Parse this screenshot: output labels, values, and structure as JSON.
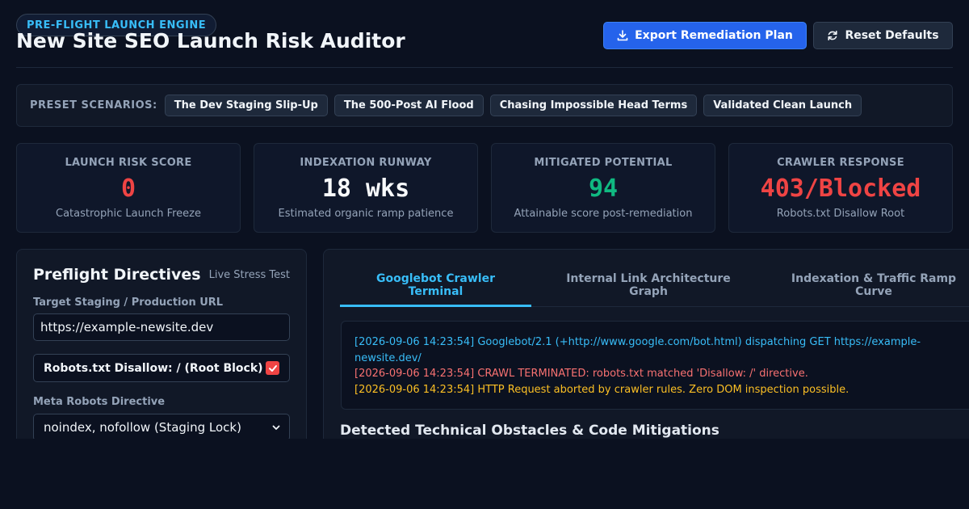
{
  "header": {
    "badge": "PRE-FLIGHT LAUNCH ENGINE",
    "title": "New Site SEO Launch Risk Auditor",
    "export_label": "Export Remediation Plan",
    "reset_label": "Reset Defaults"
  },
  "presets": {
    "label": "PRESET SCENARIOS:",
    "items": [
      "The Dev Staging Slip-Up",
      "The 500-Post AI Flood",
      "Chasing Impossible Head Terms",
      "Validated Clean Launch"
    ]
  },
  "metrics": [
    {
      "label": "LAUNCH RISK SCORE",
      "value": "0",
      "sub": "Catastrophic Launch Freeze",
      "color": "#ef4444"
    },
    {
      "label": "INDEXATION RUNWAY",
      "value": "18 wks",
      "sub": "Estimated organic ramp patience",
      "color": "#f8fafc"
    },
    {
      "label": "MITIGATED POTENTIAL",
      "value": "94",
      "sub": "Attainable score post-remediation",
      "color": "#10b981"
    },
    {
      "label": "CRAWLER RESPONSE",
      "value": "403/Blocked",
      "sub": "Robots.txt Disallow Root",
      "color": "#ef4444"
    }
  ],
  "directives": {
    "title": "Preflight Directives",
    "hint": "Live Stress Test",
    "url_label": "Target Staging / Production URL",
    "url_value": "https://example-newsite.dev",
    "robots_label": "Robots.txt Disallow: / (Root Block)",
    "robots_checked": true,
    "meta_label": "Meta Robots Directive",
    "meta_value": "noindex, nofollow (Staging Lock)"
  },
  "tabs": [
    {
      "line1": "Googlebot Crawler",
      "line2": "Terminal",
      "active": true
    },
    {
      "line1": "Internal Link Architecture",
      "line2": "Graph",
      "active": false
    },
    {
      "line1": "Indexation & Traffic Ramp",
      "line2": "Curve",
      "active": false
    }
  ],
  "terminal": [
    {
      "text": "[2026-09-06 14:23:54] Googlebot/2.1 (+http://www.google.com/bot.html) dispatching GET https://example-newsite.dev/",
      "color": "#38bdf8"
    },
    {
      "text": "[2026-09-06 14:23:54] CRAWL TERMINATED: robots.txt matched 'Disallow: /' directive.",
      "color": "#f87171"
    },
    {
      "text": "[2026-09-06 14:23:54] HTTP Request aborted by crawler rules. Zero DOM inspection possible.",
      "color": "#fbbf24"
    }
  ],
  "obstacles_title": "Detected Technical Obstacles & Code Mitigations"
}
